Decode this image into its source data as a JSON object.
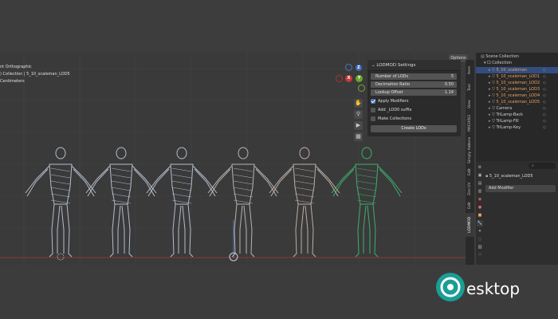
{
  "viewport": {
    "info_lines": [
      "nt Orthographic",
      ") Collection | 5_10_scaleman_LOD5",
      "Centimeters"
    ],
    "options_label": "Options",
    "gizmo": {
      "x": "X",
      "y": "Y",
      "z": "Z"
    },
    "figure_colors": [
      "#c8d4e6",
      "#c8d4e6",
      "#c8d4e6",
      "#d0c8c8",
      "#d6c2b8",
      "#3fc27a"
    ]
  },
  "lodmod": {
    "title": "LODMOD Settings",
    "fields": [
      {
        "label": "Number of LODs",
        "value": "5"
      },
      {
        "label": "Decimation Ratio",
        "value": "0.50"
      },
      {
        "label": "Lookup Offset",
        "value": "1.14"
      }
    ],
    "checks": [
      {
        "label": "Apply Modifiers",
        "on": true
      },
      {
        "label": "Add _LOD0 suffix",
        "on": false
      },
      {
        "label": "Make Collections",
        "on": false
      }
    ],
    "create_button": "Create LODs"
  },
  "sidebar_tabs": [
    "Item",
    "Tool",
    "View",
    "MACHIN3",
    "Simply Addons",
    "Edit",
    "Zen UV",
    "Edit",
    "LODMOD"
  ],
  "outliner": {
    "title": "Scene Collection",
    "collection": "Collection",
    "items": [
      {
        "name": "5_10_scaleman",
        "color": "#e8a060",
        "selected": true
      },
      {
        "name": "5_10_scaleman_LOD1",
        "color": "#e8a060",
        "selected": false
      },
      {
        "name": "5_10_scaleman_LOD2",
        "color": "#e8a060",
        "selected": false
      },
      {
        "name": "5_10_scaleman_LOD3",
        "color": "#e8a060",
        "selected": false
      },
      {
        "name": "5_10_scaleman_LOD4",
        "color": "#e8a060",
        "selected": false
      },
      {
        "name": "5_10_scaleman_LOD5",
        "color": "#e8a060",
        "selected": false
      },
      {
        "name": "Camera",
        "color": "#cfcfcf",
        "selected": false
      },
      {
        "name": "TriLamp-Back",
        "color": "#cfcfcf",
        "selected": false
      },
      {
        "name": "TriLamp-Fill",
        "color": "#cfcfcf",
        "selected": false
      },
      {
        "name": "TriLamp-Key",
        "color": "#cfcfcf",
        "selected": false
      }
    ]
  },
  "properties": {
    "search_placeholder": "",
    "object_name": "5_10_scaleman_LOD5",
    "add_modifier": "Add Modifier"
  },
  "watermark": {
    "text": "esktop"
  }
}
